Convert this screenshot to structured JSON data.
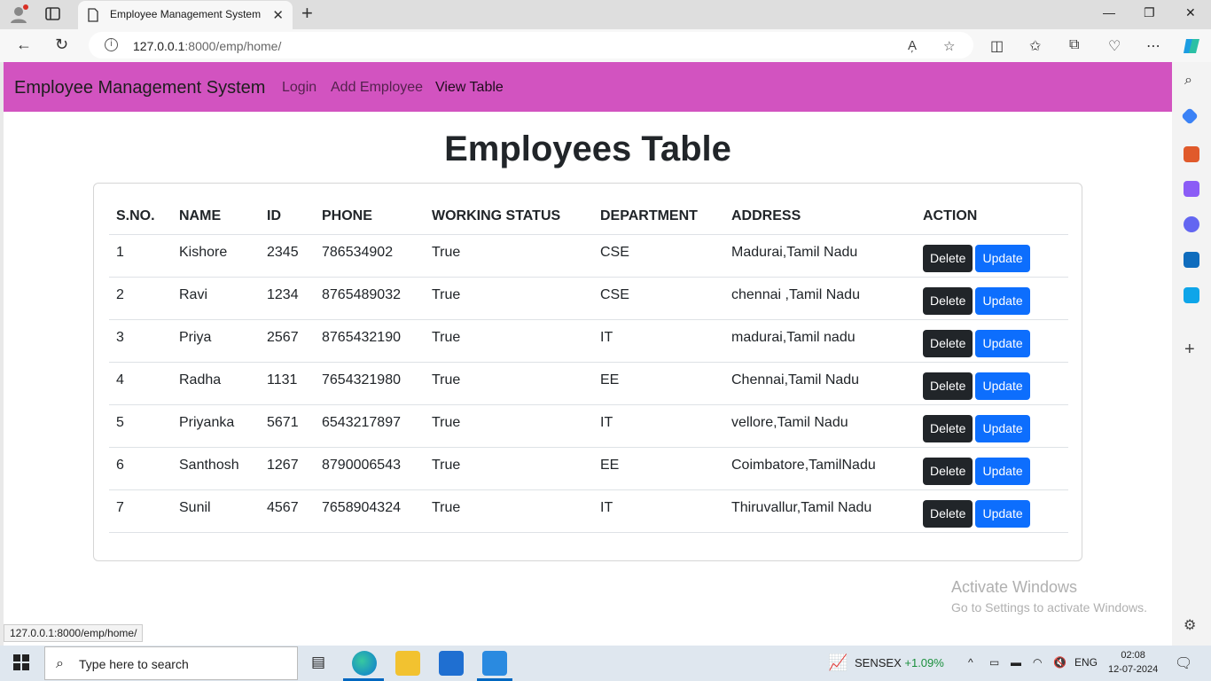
{
  "browser": {
    "tab_title": "Employee Management System",
    "url_host": "127.0.0.1",
    "url_path": ":8000/emp/home/",
    "status_url": "127.0.0.1:8000/emp/home/"
  },
  "navbar": {
    "brand": "Employee Management System",
    "links": [
      "Login",
      "Add Employee",
      "View Table"
    ]
  },
  "page": {
    "title": "Employees Table"
  },
  "table": {
    "headers": [
      "S.NO.",
      "NAME",
      "ID",
      "PHONE",
      "WORKING STATUS",
      "DEPARTMENT",
      "ADDRESS",
      "ACTION"
    ],
    "delete_label": "Delete",
    "update_label": "Update",
    "rows": [
      [
        "1",
        "Kishore",
        "2345",
        "786534902",
        "True",
        "CSE",
        "Madurai,Tamil Nadu"
      ],
      [
        "2",
        "Ravi",
        "1234",
        "8765489032",
        "True",
        "CSE",
        "chennai ,Tamil Nadu"
      ],
      [
        "3",
        "Priya",
        "2567",
        "8765432190",
        "True",
        "IT",
        "madurai,Tamil nadu"
      ],
      [
        "4",
        "Radha",
        "1131",
        "7654321980",
        "True",
        "EE",
        "Chennai,Tamil Nadu"
      ],
      [
        "5",
        "Priyanka",
        "5671",
        "6543217897",
        "True",
        "IT",
        "vellore,Tamil Nadu"
      ],
      [
        "6",
        "Santhosh",
        "1267",
        "8790006543",
        "True",
        "EE",
        "Coimbatore,TamilNadu"
      ],
      [
        "7",
        "Sunil",
        "4567",
        "7658904324",
        "True",
        "IT",
        "Thiruvallur,Tamil Nadu"
      ]
    ]
  },
  "watermark": {
    "line1": "Activate Windows",
    "line2": "Go to Settings to activate Windows."
  },
  "taskbar": {
    "search_placeholder": "Type here to search",
    "sensex_label": "SENSEX",
    "sensex_change": "+1.09%",
    "language": "ENG",
    "time": "02:08",
    "date": "12-07-2024"
  },
  "colors": {
    "navbar": "#d253c0",
    "delete_btn": "#212529",
    "update_btn": "#0d6efd"
  }
}
